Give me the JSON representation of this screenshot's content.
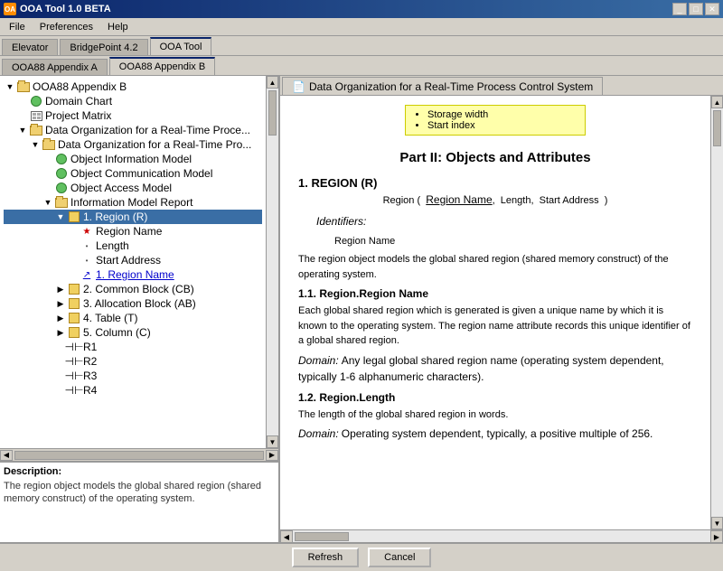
{
  "titleBar": {
    "title": "OOA Tool 1.0 BETA",
    "icon": "OA",
    "buttons": [
      "_",
      "□",
      "✕"
    ]
  },
  "menuBar": {
    "items": [
      "File",
      "Preferences",
      "Help"
    ]
  },
  "tabsRow1": {
    "tabs": [
      "Elevator",
      "BridgePoint 4.2",
      "OOA Tool"
    ],
    "active": 2
  },
  "tabsRow2": {
    "tabs": [
      "OOA88 Appendix A",
      "OOA88 Appendix B"
    ],
    "active": 1
  },
  "tree": {
    "items": [
      {
        "id": "ooa88b",
        "label": "OOA88 Appendix B",
        "level": 0,
        "type": "root",
        "expanded": true
      },
      {
        "id": "domain",
        "label": "Domain Chart",
        "level": 1,
        "type": "doc",
        "expanded": false
      },
      {
        "id": "project",
        "label": "Project Matrix",
        "level": 1,
        "type": "grid",
        "expanded": false
      },
      {
        "id": "datorg",
        "label": "Data Organization for a Real-Time Proce...",
        "level": 1,
        "type": "folder-open",
        "expanded": true
      },
      {
        "id": "datorg2",
        "label": "Data Organization for a Real-Time Pro...",
        "level": 2,
        "type": "folder-open",
        "expanded": true
      },
      {
        "id": "objinfo",
        "label": "Object Information Model",
        "level": 3,
        "type": "green",
        "expanded": false
      },
      {
        "id": "objcomm",
        "label": "Object Communication Model",
        "level": 3,
        "type": "green",
        "expanded": false
      },
      {
        "id": "objaccess",
        "label": "Object Access Model",
        "level": 3,
        "type": "green",
        "expanded": false
      },
      {
        "id": "infomodel",
        "label": "Information Model Report",
        "level": 3,
        "type": "folder-open",
        "expanded": true
      },
      {
        "id": "region",
        "label": "1. Region (R)",
        "level": 4,
        "type": "yellow-sel",
        "selected": true,
        "expanded": true
      },
      {
        "id": "regname",
        "label": "Region Name",
        "level": 5,
        "type": "star"
      },
      {
        "id": "length",
        "label": "Length",
        "level": 5,
        "type": "bullet"
      },
      {
        "id": "startaddr",
        "label": "Start Address",
        "level": 5,
        "type": "bullet"
      },
      {
        "id": "regname2",
        "label": "1. Region Name",
        "level": 5,
        "type": "link"
      },
      {
        "id": "common",
        "label": "2. Common Block (CB)",
        "level": 4,
        "type": "yellow",
        "expanded": false
      },
      {
        "id": "allocblock",
        "label": "3. Allocation Block (AB)",
        "level": 4,
        "type": "yellow",
        "expanded": false
      },
      {
        "id": "table",
        "label": "4. Table (T)",
        "level": 4,
        "type": "yellow",
        "expanded": false
      },
      {
        "id": "column",
        "label": "5. Column (C)",
        "level": 4,
        "type": "yellow",
        "expanded": false
      },
      {
        "id": "r1",
        "label": "R1",
        "level": 4,
        "type": "rel"
      },
      {
        "id": "r2",
        "label": "R2",
        "level": 4,
        "type": "rel"
      },
      {
        "id": "r3",
        "label": "R3",
        "level": 4,
        "type": "rel"
      },
      {
        "id": "r4",
        "label": "R4",
        "level": 4,
        "type": "rel"
      }
    ]
  },
  "description": {
    "label": "Description:",
    "text": "The region object models the global shared region (shared memory construct) of the operating system."
  },
  "docTab": {
    "label": "Data Organization for a Real-Time Process Control System",
    "icon": "doc"
  },
  "document": {
    "yellowBox": {
      "items": [
        "Storage width",
        "Start index"
      ]
    },
    "title": "Part II: Objects and Attributes",
    "section1": {
      "heading": "1. REGION (R)",
      "signature": "Region (  Region Name,  Length,  Start Address  )",
      "identifiers": "Identifiers:",
      "identifierValue": "Region Name",
      "desc": "The region object models the global shared region (shared memory construct) of the operating system.",
      "sub1": {
        "heading": "1.1. Region.Region Name",
        "text": "Each global shared region which is generated is given a unique name by which it is known to the operating system.  The region name attribute records this unique identifier of a global shared region.",
        "domain": "Domain:  Any legal global shared region name (operating system dependent, typically 1-6 alphanumeric characters)."
      },
      "sub2": {
        "heading": "1.2. Region.Length",
        "text": "The length of the global shared region in words.",
        "domain": "Domain:  Operating system dependent, typically, a positive multiple of 256."
      }
    }
  },
  "buttons": {
    "refresh": "Refresh",
    "cancel": "Cancel"
  }
}
